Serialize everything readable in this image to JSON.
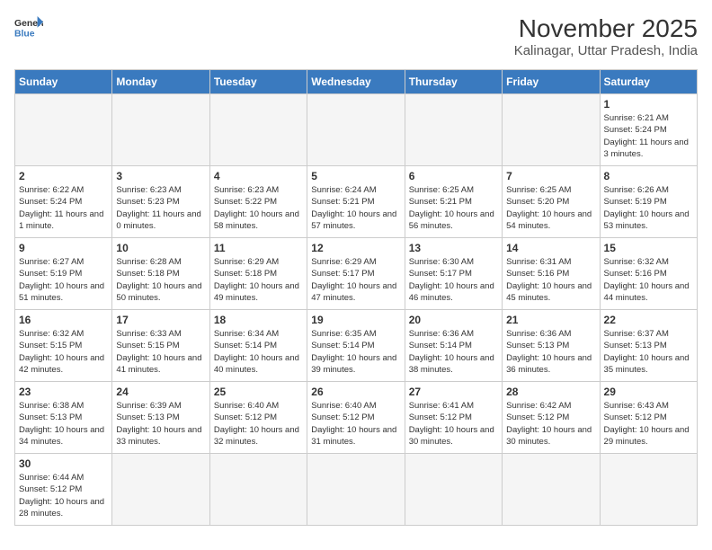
{
  "header": {
    "logo_line1": "General",
    "logo_line2": "Blue",
    "month": "November 2025",
    "location": "Kalinagar, Uttar Pradesh, India"
  },
  "days_of_week": [
    "Sunday",
    "Monday",
    "Tuesday",
    "Wednesday",
    "Thursday",
    "Friday",
    "Saturday"
  ],
  "weeks": [
    [
      {
        "day": "",
        "info": ""
      },
      {
        "day": "",
        "info": ""
      },
      {
        "day": "",
        "info": ""
      },
      {
        "day": "",
        "info": ""
      },
      {
        "day": "",
        "info": ""
      },
      {
        "day": "",
        "info": ""
      },
      {
        "day": "1",
        "info": "Sunrise: 6:21 AM\nSunset: 5:24 PM\nDaylight: 11 hours\nand 3 minutes."
      }
    ],
    [
      {
        "day": "2",
        "info": "Sunrise: 6:22 AM\nSunset: 5:24 PM\nDaylight: 11 hours\nand 1 minute."
      },
      {
        "day": "3",
        "info": "Sunrise: 6:23 AM\nSunset: 5:23 PM\nDaylight: 11 hours\nand 0 minutes."
      },
      {
        "day": "4",
        "info": "Sunrise: 6:23 AM\nSunset: 5:22 PM\nDaylight: 10 hours\nand 58 minutes."
      },
      {
        "day": "5",
        "info": "Sunrise: 6:24 AM\nSunset: 5:21 PM\nDaylight: 10 hours\nand 57 minutes."
      },
      {
        "day": "6",
        "info": "Sunrise: 6:25 AM\nSunset: 5:21 PM\nDaylight: 10 hours\nand 56 minutes."
      },
      {
        "day": "7",
        "info": "Sunrise: 6:25 AM\nSunset: 5:20 PM\nDaylight: 10 hours\nand 54 minutes."
      },
      {
        "day": "8",
        "info": "Sunrise: 6:26 AM\nSunset: 5:19 PM\nDaylight: 10 hours\nand 53 minutes."
      }
    ],
    [
      {
        "day": "9",
        "info": "Sunrise: 6:27 AM\nSunset: 5:19 PM\nDaylight: 10 hours\nand 51 minutes."
      },
      {
        "day": "10",
        "info": "Sunrise: 6:28 AM\nSunset: 5:18 PM\nDaylight: 10 hours\nand 50 minutes."
      },
      {
        "day": "11",
        "info": "Sunrise: 6:29 AM\nSunset: 5:18 PM\nDaylight: 10 hours\nand 49 minutes."
      },
      {
        "day": "12",
        "info": "Sunrise: 6:29 AM\nSunset: 5:17 PM\nDaylight: 10 hours\nand 47 minutes."
      },
      {
        "day": "13",
        "info": "Sunrise: 6:30 AM\nSunset: 5:17 PM\nDaylight: 10 hours\nand 46 minutes."
      },
      {
        "day": "14",
        "info": "Sunrise: 6:31 AM\nSunset: 5:16 PM\nDaylight: 10 hours\nand 45 minutes."
      },
      {
        "day": "15",
        "info": "Sunrise: 6:32 AM\nSunset: 5:16 PM\nDaylight: 10 hours\nand 44 minutes."
      }
    ],
    [
      {
        "day": "16",
        "info": "Sunrise: 6:32 AM\nSunset: 5:15 PM\nDaylight: 10 hours\nand 42 minutes."
      },
      {
        "day": "17",
        "info": "Sunrise: 6:33 AM\nSunset: 5:15 PM\nDaylight: 10 hours\nand 41 minutes."
      },
      {
        "day": "18",
        "info": "Sunrise: 6:34 AM\nSunset: 5:14 PM\nDaylight: 10 hours\nand 40 minutes."
      },
      {
        "day": "19",
        "info": "Sunrise: 6:35 AM\nSunset: 5:14 PM\nDaylight: 10 hours\nand 39 minutes."
      },
      {
        "day": "20",
        "info": "Sunrise: 6:36 AM\nSunset: 5:14 PM\nDaylight: 10 hours\nand 38 minutes."
      },
      {
        "day": "21",
        "info": "Sunrise: 6:36 AM\nSunset: 5:13 PM\nDaylight: 10 hours\nand 36 minutes."
      },
      {
        "day": "22",
        "info": "Sunrise: 6:37 AM\nSunset: 5:13 PM\nDaylight: 10 hours\nand 35 minutes."
      }
    ],
    [
      {
        "day": "23",
        "info": "Sunrise: 6:38 AM\nSunset: 5:13 PM\nDaylight: 10 hours\nand 34 minutes."
      },
      {
        "day": "24",
        "info": "Sunrise: 6:39 AM\nSunset: 5:13 PM\nDaylight: 10 hours\nand 33 minutes."
      },
      {
        "day": "25",
        "info": "Sunrise: 6:40 AM\nSunset: 5:12 PM\nDaylight: 10 hours\nand 32 minutes."
      },
      {
        "day": "26",
        "info": "Sunrise: 6:40 AM\nSunset: 5:12 PM\nDaylight: 10 hours\nand 31 minutes."
      },
      {
        "day": "27",
        "info": "Sunrise: 6:41 AM\nSunset: 5:12 PM\nDaylight: 10 hours\nand 30 minutes."
      },
      {
        "day": "28",
        "info": "Sunrise: 6:42 AM\nSunset: 5:12 PM\nDaylight: 10 hours\nand 30 minutes."
      },
      {
        "day": "29",
        "info": "Sunrise: 6:43 AM\nSunset: 5:12 PM\nDaylight: 10 hours\nand 29 minutes."
      }
    ],
    [
      {
        "day": "30",
        "info": "Sunrise: 6:44 AM\nSunset: 5:12 PM\nDaylight: 10 hours\nand 28 minutes."
      },
      {
        "day": "",
        "info": ""
      },
      {
        "day": "",
        "info": ""
      },
      {
        "day": "",
        "info": ""
      },
      {
        "day": "",
        "info": ""
      },
      {
        "day": "",
        "info": ""
      },
      {
        "day": "",
        "info": ""
      }
    ]
  ]
}
